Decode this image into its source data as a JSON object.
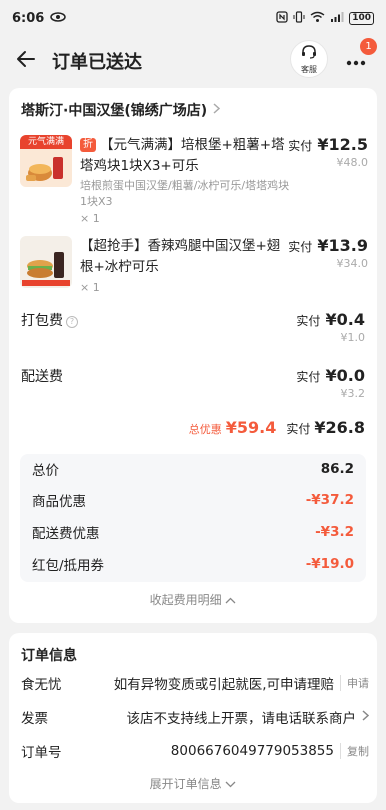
{
  "status_bar": {
    "time": "6:06",
    "battery": "100"
  },
  "nav": {
    "title": "订单已送达",
    "service_label": "客服",
    "badge_count": "1"
  },
  "store": {
    "name": "塔斯汀·中国汉堡(锦绣广场店)"
  },
  "items": [
    {
      "thumb_text": "元气满满",
      "tag": "折",
      "title": "【元气满满】培根堡+粗薯+塔塔鸡块1块X3+可乐",
      "subtitle": "培根煎蛋中国汉堡/粗薯/冰柠可乐/塔塔鸡块1块X3",
      "qty": "× 1",
      "paid_label": "实付",
      "paid_amount": "¥12.5",
      "original": "¥48.0"
    },
    {
      "thumb_text": "",
      "tag": "",
      "title": "【超抢手】香辣鸡腿中国汉堡+翅根+冰柠可乐",
      "subtitle": "",
      "qty": "× 1",
      "paid_label": "实付",
      "paid_amount": "¥13.9",
      "original": "¥34.0"
    }
  ],
  "fees": [
    {
      "label": "打包费",
      "paid_label": "实付",
      "amount": "¥0.4",
      "original": "¥1.0"
    },
    {
      "label": "配送费",
      "paid_label": "实付",
      "amount": "¥0.0",
      "original": "¥3.2"
    }
  ],
  "totals": {
    "discount_label": "总优惠",
    "discount_amount": "¥59.4",
    "paid_label": "实付",
    "paid_amount": "¥26.8"
  },
  "summary": [
    {
      "label": "总价",
      "value": "86.2"
    },
    {
      "label": "商品优惠",
      "value": "-¥37.2"
    },
    {
      "label": "配送费优惠",
      "value": "-¥3.2"
    },
    {
      "label": "红包/抵用券",
      "value": "-¥19.0"
    }
  ],
  "collapse_label": "收起费用明细",
  "order_info": {
    "title": "订单信息",
    "rows": [
      {
        "key": "食无忧",
        "value": "如有异物变质或引起就医,可申请理赔",
        "action": "申请"
      },
      {
        "key": "发票",
        "value": "该店不支持线上开票，请电话联系商户",
        "action": ""
      },
      {
        "key": "订单号",
        "value": "8006676049779053855",
        "action": "复制"
      }
    ],
    "expand_label": "展开订单信息"
  },
  "colors": {
    "accent": "#f45b3c",
    "text": "#222222",
    "muted": "#999999"
  }
}
